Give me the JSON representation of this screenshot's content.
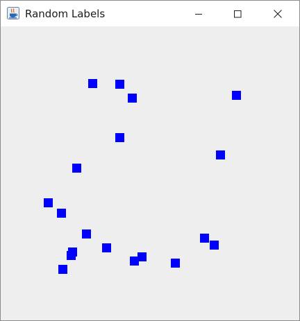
{
  "window": {
    "title": "Random Labels",
    "icon": "java-app-icon",
    "controls": [
      "minimize-icon",
      "maximize-icon",
      "close-icon"
    ]
  },
  "content": {
    "background": "#eeeeee",
    "square_color": "#0000ff",
    "squares_count": 20
  }
}
